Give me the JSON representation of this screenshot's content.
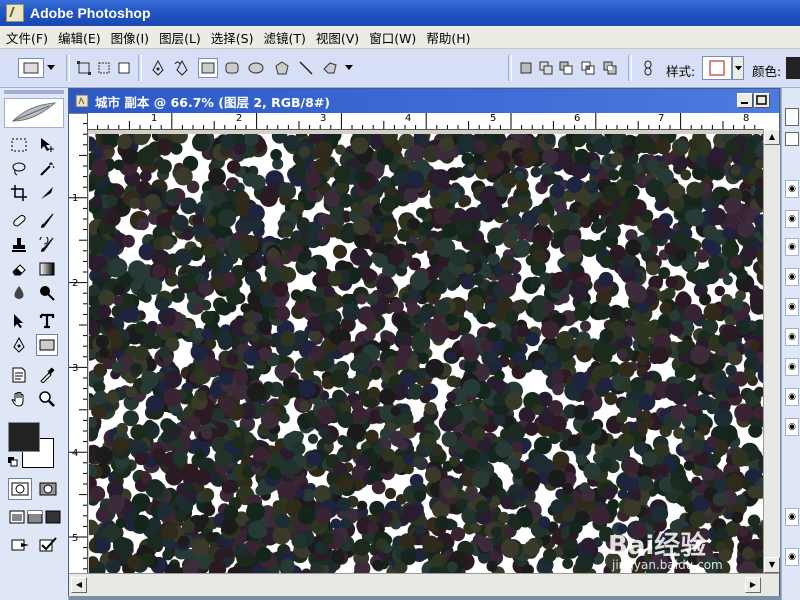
{
  "app": {
    "title": "Adobe Photoshop"
  },
  "menu": [
    "文件(F)",
    "编辑(E)",
    "图像(I)",
    "图层(L)",
    "选择(S)",
    "滤镜(T)",
    "视图(V)",
    "窗口(W)",
    "帮助(H)"
  ],
  "options_bar": {
    "style_label": "样式:",
    "color_label": "颜色:",
    "icons": [
      "rect-mode-icon",
      "dropdown-icon",
      "shape-layers-icon",
      "paths-icon",
      "fill-pixels-icon",
      "pen-icon",
      "freeform-pen-icon",
      "rectangle-shape-icon",
      "rounded-rect-icon",
      "ellipse-icon",
      "polygon-icon",
      "line-icon",
      "custom-shape-icon",
      "combine-icons",
      "link-icon",
      "style-swatch",
      "color-swatch"
    ]
  },
  "document": {
    "title": "城市 副本 @ 66.7% (图层 2, RGB/8#)",
    "ruler_top": [
      "1",
      "2",
      "3",
      "4",
      "5",
      "6",
      "7",
      "8"
    ],
    "ruler_left": [
      "1",
      "2",
      "3",
      "4",
      "5"
    ],
    "content": "dense dark multicolored dots on white"
  },
  "toolbox": {
    "tools": [
      "marquee-icon",
      "move-icon",
      "lasso-icon",
      "magic-wand-icon",
      "crop-icon",
      "slice-icon",
      "healing-brush-icon",
      "brush-icon",
      "clone-stamp-icon",
      "history-brush-icon",
      "eraser-icon",
      "gradient-icon",
      "blur-icon",
      "dodge-icon",
      "path-select-icon",
      "type-icon",
      "pen-icon",
      "shape-icon",
      "notes-icon",
      "eyedropper-icon",
      "hand-icon",
      "zoom-icon"
    ]
  },
  "colors": {
    "titlebar": "#2357c6",
    "foreground": "#222222",
    "background": "#ffffff",
    "accent": "#d06060"
  },
  "watermark": {
    "brand": "Bai经验",
    "url": "jingyan.baidu.com"
  }
}
